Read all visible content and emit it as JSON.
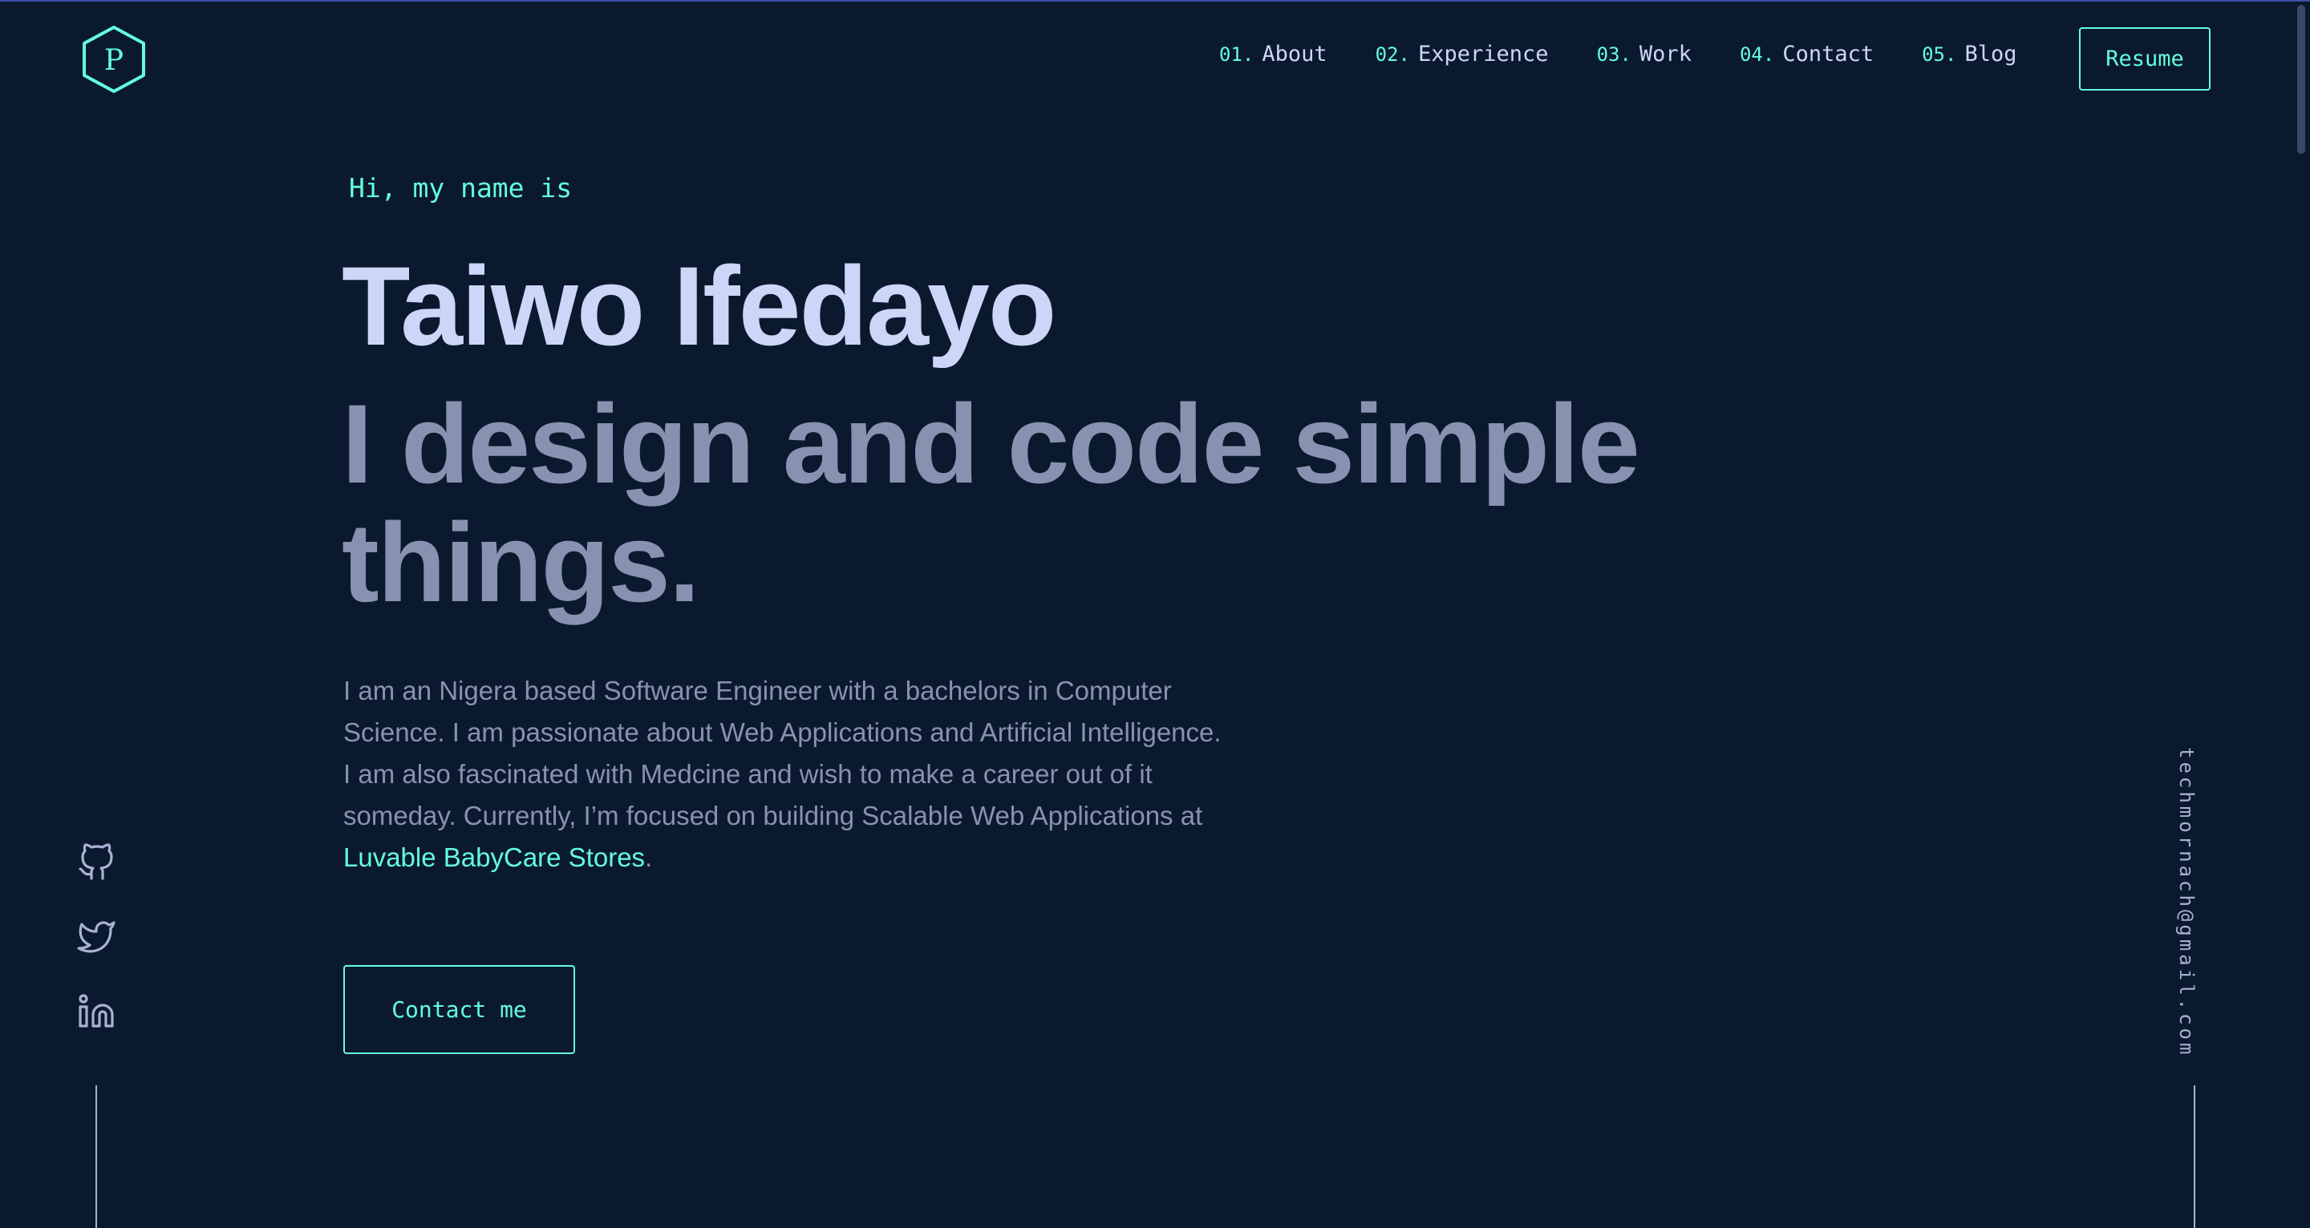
{
  "logo": {
    "letter": "P",
    "icon": "hexagon-logo-icon"
  },
  "nav": {
    "items": [
      {
        "num": "01.",
        "label": "About"
      },
      {
        "num": "02.",
        "label": "Experience"
      },
      {
        "num": "03.",
        "label": "Work"
      },
      {
        "num": "04.",
        "label": "Contact"
      },
      {
        "num": "05.",
        "label": "Blog"
      }
    ],
    "resume_label": "Resume"
  },
  "hero": {
    "greeting": "Hi, my name is",
    "name": "Taiwo Ifedayo",
    "tagline": "I design and code simple things.",
    "bio_text": "I am an Nigera based Software Engineer with a bachelors in Computer Science. I am passionate about Web Applications and Artificial Intelligence. I am also fascinated with Medcine and wish to make a career out of it someday. Currently, I’m focused on building Scalable Web Applications at ",
    "bio_link": "Luvable BabyCare Stores",
    "bio_end": ".",
    "contact_label": "Contact me"
  },
  "social": {
    "icons": [
      "github-icon",
      "twitter-icon",
      "linkedin-icon"
    ]
  },
  "email": "techmornach@gmail.com",
  "colors": {
    "background": "#0b192f",
    "accent": "#64ffda",
    "heading": "#ccd6f6",
    "body": "#8892b0",
    "muted": "#a8b2d1"
  }
}
